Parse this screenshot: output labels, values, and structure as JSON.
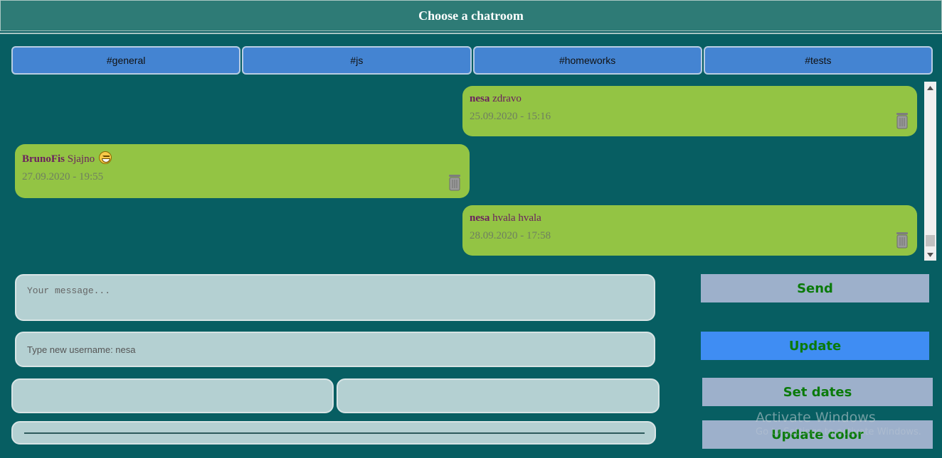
{
  "header": {
    "title": "Choose a chatroom"
  },
  "rooms": [
    {
      "label": "#general"
    },
    {
      "label": "#js"
    },
    {
      "label": "#homeworks"
    },
    {
      "label": "#tests"
    }
  ],
  "messages": [
    {
      "user": "nesa",
      "text": "zdravo",
      "date": "25.09.2020 - 15:16",
      "side": "right",
      "trash_icon": "trash-icon"
    },
    {
      "user": "BrunoFis",
      "text": "Sjajno",
      "emoji": "grinning-face-icon",
      "date": "27.09.2020 - 19:55",
      "side": "left",
      "trash_icon": "trash-icon"
    },
    {
      "user": "nesa",
      "text": "hvala hvala",
      "date": "28.09.2020 - 17:58",
      "side": "right",
      "trash_icon": "trash-icon"
    }
  ],
  "composer": {
    "message_placeholder": "Your message...",
    "username_placeholder": "Type new username: nesa",
    "date_from_value": "",
    "date_to_value": ""
  },
  "buttons": {
    "send": "Send",
    "update": "Update",
    "set_dates": "Set dates",
    "update_color": "Update color"
  },
  "watermark": {
    "title": "Activate Windows",
    "subtitle": "Go to Settings to activate Windows."
  },
  "colors": {
    "background": "#075e62",
    "header": "#2e7b76",
    "room_button": "#4484d2",
    "bubble": "#93c444",
    "username": "#6b1f5e",
    "button_text": "#0a7a0a",
    "update_button": "#3f8df3",
    "muted_button": "#9db0cb"
  }
}
